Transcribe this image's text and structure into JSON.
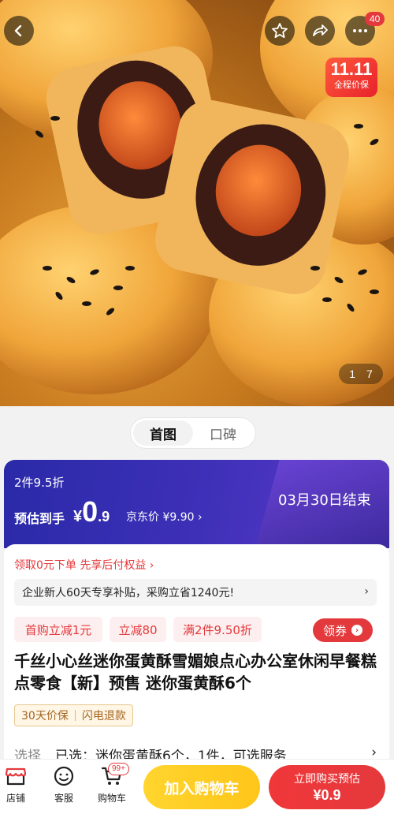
{
  "header": {
    "back_icon": "chevron-left-icon",
    "favorite_icon": "star-icon",
    "share_icon": "share-icon",
    "more_icon": "more-dots-icon",
    "message_count": "40"
  },
  "gallery": {
    "promo_badge_big": "11.11",
    "promo_badge_small": "全程价保",
    "current_index": "1",
    "total_count": "7"
  },
  "tabs": [
    {
      "label": "首图",
      "active": true
    },
    {
      "label": "口碑",
      "active": false
    }
  ],
  "price_banner": {
    "deal_tag": "2件9.5折",
    "estimate_label": "预估到手",
    "currency": "¥",
    "price_int": "0",
    "price_dec": ".9",
    "jd_price": "京东价 ¥9.90 ›",
    "end_date": "03月30日结束",
    "colors": {
      "banner_start": "#2a2aa8",
      "banner_end": "#5a3ac9"
    }
  },
  "card": {
    "paylater": "领取0元下单 先享后付权益 ›",
    "subsidy": "企业新人60天专享补贴，采购立省1240元!",
    "subsidy_chevron": "›",
    "coupons": [
      "首购立减1元",
      "立减80",
      "满2件9.50折"
    ],
    "claim_label": "领券",
    "title": "千丝小心丝迷你蛋黄酥雪媚娘点心办公室休闲早餐糕点零食【新】预售 迷你蛋黄酥6个",
    "service_tags": [
      "30天价保",
      "闪电退款"
    ],
    "select_label": "选择",
    "select_value": "已选：迷你蛋黄酥6个，1件，可选服务",
    "select_chevron": "›"
  },
  "bottom_bar": {
    "store_label": "店铺",
    "service_label": "客服",
    "cart_label": "购物车",
    "cart_count": "99+",
    "add_to_cart": "加入购物车",
    "buy_now_line1": "立即购买预估",
    "buy_now_line2": "¥0.9",
    "accent_color": "#e4393c",
    "add_cart_color": "#ffc51a"
  }
}
